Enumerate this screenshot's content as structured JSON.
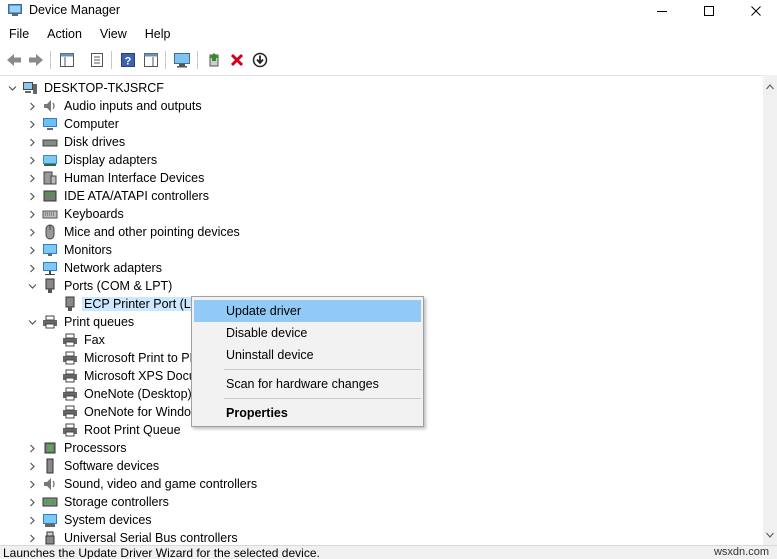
{
  "window": {
    "title": "Device Manager"
  },
  "menu": [
    "File",
    "Action",
    "View",
    "Help"
  ],
  "toolbar": {
    "buttons": [
      "back-icon",
      "forward-icon",
      "show-hide-console-tree-icon",
      "properties-icon",
      "help-icon",
      "action-pane-icon",
      "monitor-icon",
      "add-driver-icon",
      "uninstall-icon",
      "update-driver-icon"
    ]
  },
  "tree": {
    "root": "DESKTOP-TKJSRCF",
    "items": [
      {
        "label": "Audio inputs and outputs",
        "icon": "speaker-icon"
      },
      {
        "label": "Computer",
        "icon": "computer-icon"
      },
      {
        "label": "Disk drives",
        "icon": "disk-drive-icon"
      },
      {
        "label": "Display adapters",
        "icon": "display-adapter-icon"
      },
      {
        "label": "Human Interface Devices",
        "icon": "hid-icon"
      },
      {
        "label": "IDE ATA/ATAPI controllers",
        "icon": "ide-controller-icon"
      },
      {
        "label": "Keyboards",
        "icon": "keyboard-icon"
      },
      {
        "label": "Mice and other pointing devices",
        "icon": "mouse-icon"
      },
      {
        "label": "Monitors",
        "icon": "monitor-icon"
      },
      {
        "label": "Network adapters",
        "icon": "network-adapter-icon"
      },
      {
        "label": "Ports (COM & LPT)",
        "icon": "port-icon",
        "expanded": true
      },
      {
        "label": "ECP Printer Port (LPT",
        "icon": "printer-port-icon",
        "child": true,
        "selected": true
      },
      {
        "label": "Print queues",
        "icon": "printer-icon",
        "expanded": true
      },
      {
        "label": "Fax",
        "icon": "printer-icon",
        "child": true
      },
      {
        "label": "Microsoft Print to PD",
        "icon": "printer-icon",
        "child": true
      },
      {
        "label": "Microsoft XPS Docum",
        "icon": "printer-icon",
        "child": true
      },
      {
        "label": "OneNote (Desktop)",
        "icon": "printer-icon",
        "child": true
      },
      {
        "label": "OneNote for Window",
        "icon": "printer-icon",
        "child": true
      },
      {
        "label": "Root Print Queue",
        "icon": "printer-icon",
        "child": true
      },
      {
        "label": "Processors",
        "icon": "processor-icon"
      },
      {
        "label": "Software devices",
        "icon": "software-device-icon"
      },
      {
        "label": "Sound, video and game controllers",
        "icon": "speaker-icon"
      },
      {
        "label": "Storage controllers",
        "icon": "storage-controller-icon"
      },
      {
        "label": "System devices",
        "icon": "system-device-icon"
      },
      {
        "label": "Universal Serial Bus controllers",
        "icon": "usb-icon"
      }
    ]
  },
  "context_menu": {
    "items": [
      "Update driver",
      "Disable device",
      "Uninstall device",
      "Scan for hardware changes",
      "Properties"
    ]
  },
  "status": {
    "text": "Launches the Update Driver Wizard for the selected device."
  },
  "watermark": "wsxdn.com",
  "colors": {
    "selection": "#cce8ff",
    "menu_hover": "#91c9f7",
    "uninstall_red": "#d0021b",
    "add_green": "#2e8b2e"
  }
}
